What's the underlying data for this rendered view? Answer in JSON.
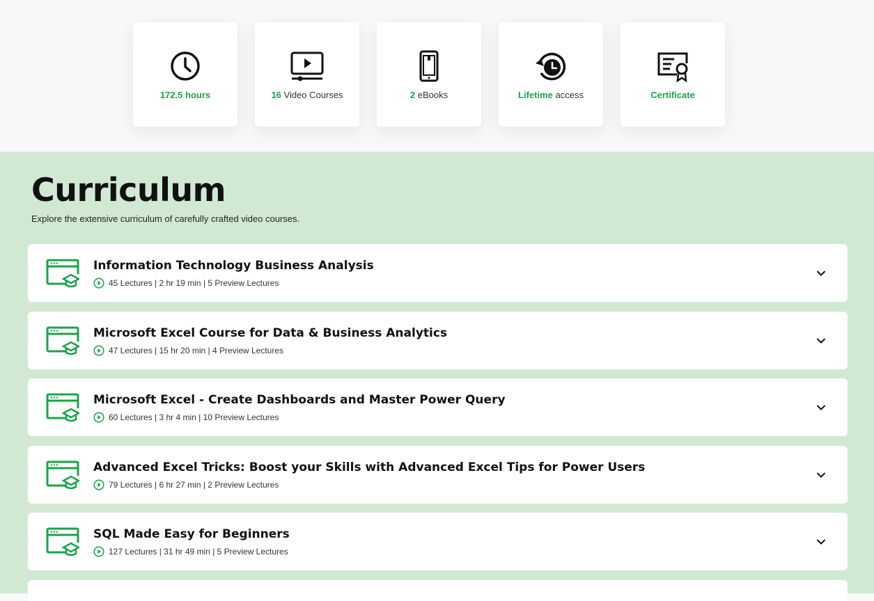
{
  "features": [
    {
      "icon": "clock-icon",
      "strong": "172.5 hours",
      "rest": ""
    },
    {
      "icon": "video-player-icon",
      "strong": "16",
      "rest": " Video Courses"
    },
    {
      "icon": "ebook-device-icon",
      "strong": "2",
      "rest": " eBooks"
    },
    {
      "icon": "lifetime-clock-icon",
      "strong": "Lifetime",
      "rest": " access"
    },
    {
      "icon": "certificate-icon",
      "strong": "Certificate",
      "rest": ""
    }
  ],
  "curriculum": {
    "title": "Curriculum",
    "subtitle": "Explore the extensive curriculum of carefully crafted video courses.",
    "courses": [
      {
        "title": "Information Technology Business Analysis",
        "meta": "45 Lectures | 2 hr 19 min | 5 Preview Lectures"
      },
      {
        "title": "Microsoft Excel Course for Data & Business Analytics",
        "meta": "47 Lectures | 15 hr 20 min | 4 Preview Lectures"
      },
      {
        "title": "Microsoft Excel - Create Dashboards and Master Power Query",
        "meta": "60 Lectures | 3 hr 4 min | 10 Preview Lectures"
      },
      {
        "title": "Advanced Excel Tricks: Boost your Skills with Advanced Excel Tips for Power Users",
        "meta": "79 Lectures | 6 hr 27 min | 2 Preview Lectures"
      },
      {
        "title": "SQL Made Easy for Beginners",
        "meta": "127 Lectures | 31 hr 49 min | 5 Preview Lectures"
      }
    ]
  },
  "colors": {
    "accent": "#1aa34a",
    "section_bg": "#d1e9d3"
  }
}
